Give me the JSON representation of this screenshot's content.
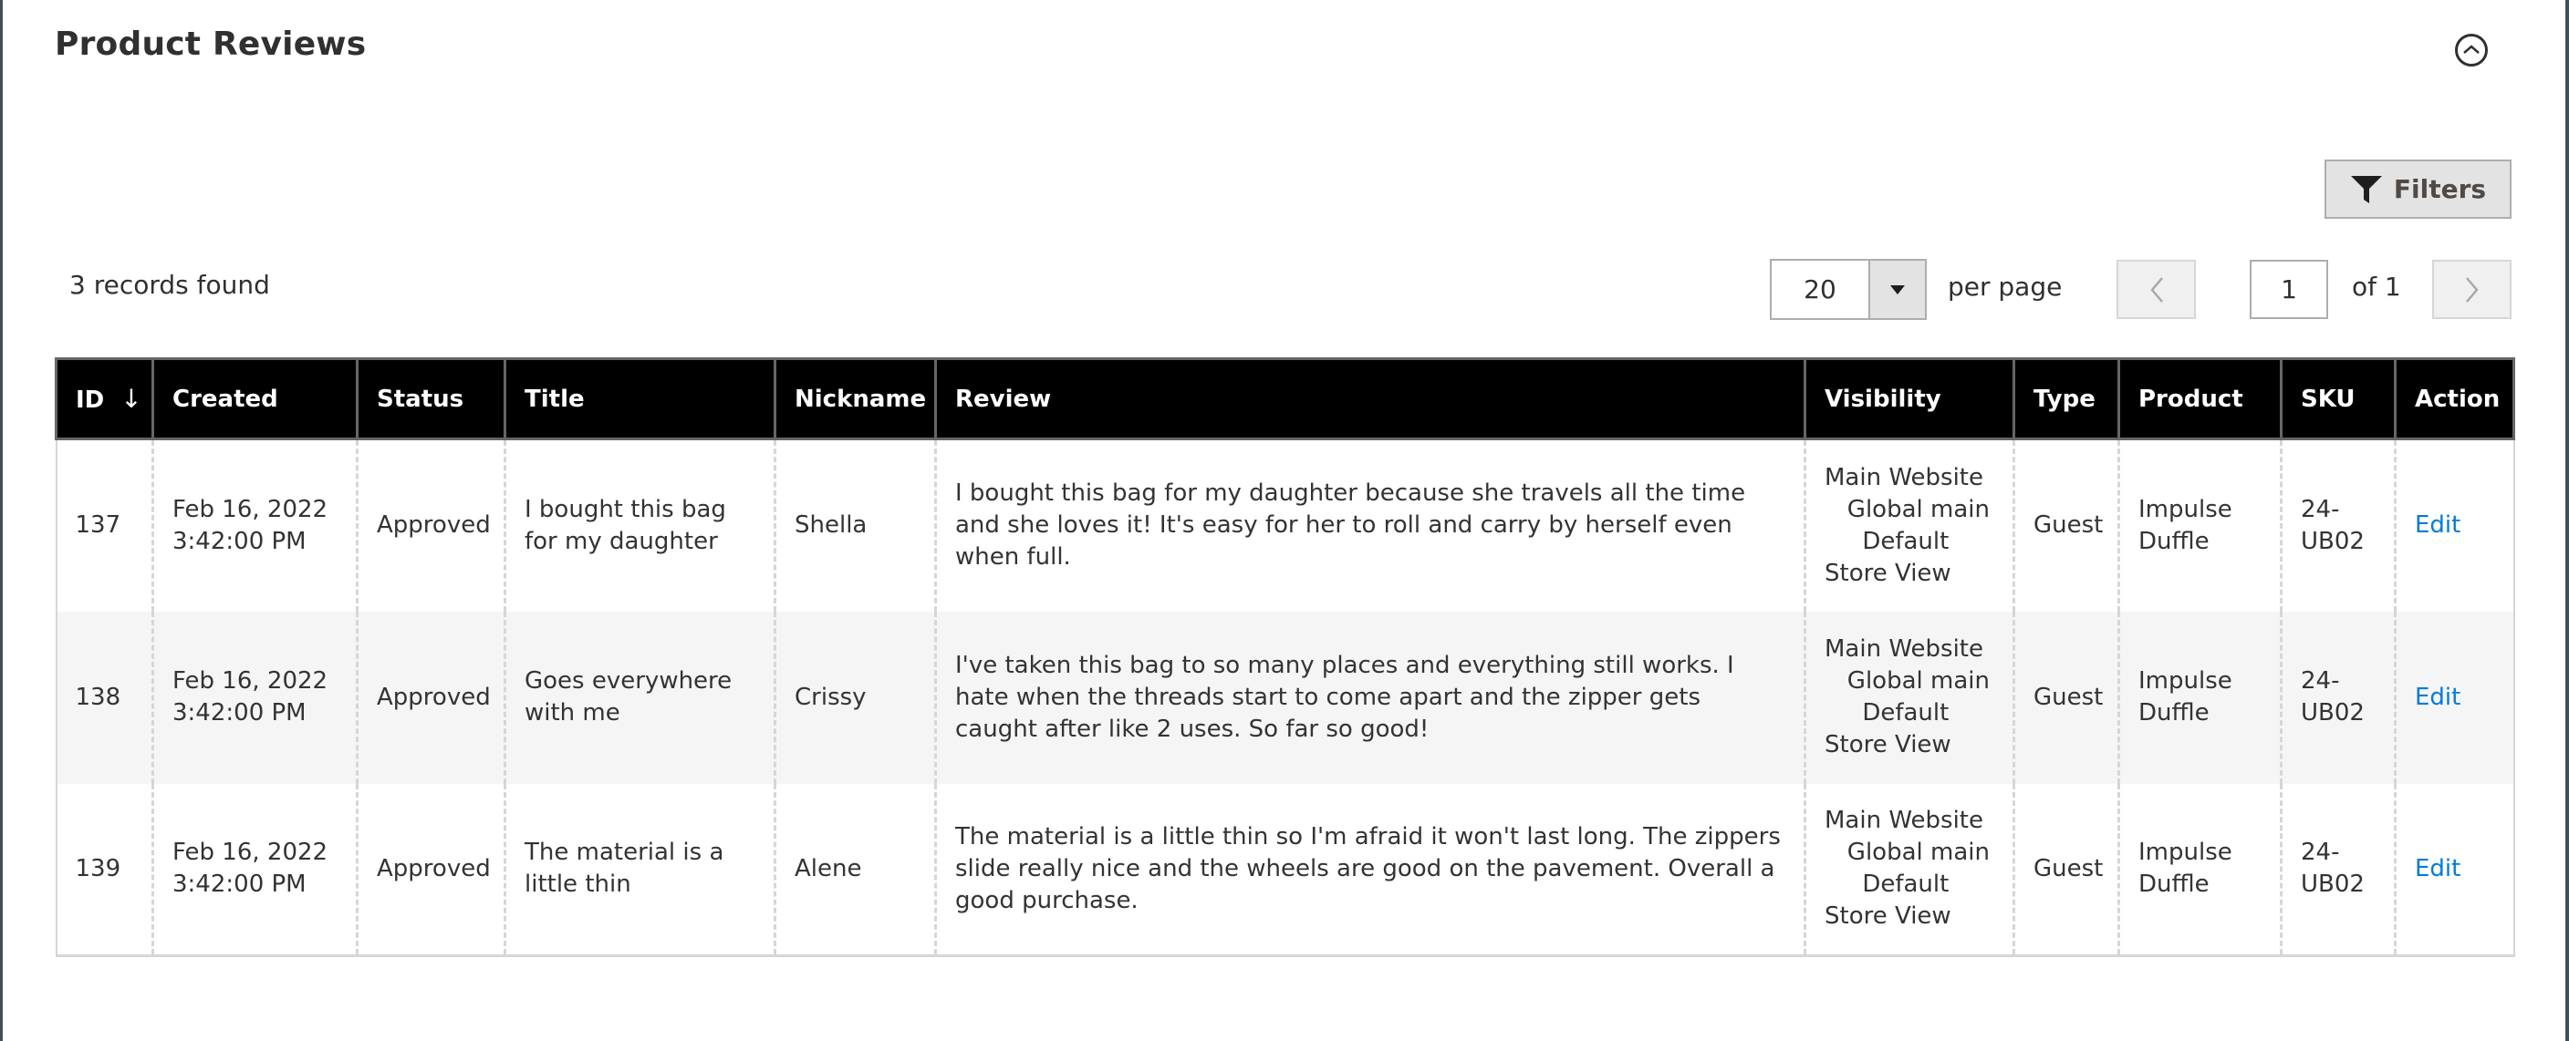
{
  "section": {
    "title": "Product Reviews",
    "collapse_icon": "chevron-up-circle-icon"
  },
  "toolbar": {
    "filters_label": "Filters",
    "filters_icon": "filter-funnel-icon",
    "records_found": "3 records found",
    "per_page_value": "20",
    "per_page_label": "per page",
    "current_page": "1",
    "page_of": "of 1",
    "prev_icon": "chevron-left-icon",
    "next_icon": "chevron-right-icon"
  },
  "grid": {
    "columns": [
      "ID",
      "Created",
      "Status",
      "Title",
      "Nickname",
      "Review",
      "Visibility",
      "Type",
      "Product",
      "SKU",
      "Action"
    ],
    "sort_indicator": "↓",
    "rows": [
      {
        "id": "137",
        "created": [
          "Feb 16, 2022",
          "3:42:00 PM"
        ],
        "status": "Approved",
        "title": "I bought this bag for my daughter",
        "nickname": "Shella",
        "review": "I bought this bag for my daughter because she travels all the time and she loves it! It's easy for her to roll and carry by herself even when full.",
        "visibility": [
          "Main Website",
          "   Global main",
          "     Default",
          "Store View"
        ],
        "type": "Guest",
        "product": "Impulse Duffle",
        "sku": "24-UB02",
        "action": "Edit"
      },
      {
        "id": "138",
        "created": [
          "Feb 16, 2022",
          "3:42:00 PM"
        ],
        "status": "Approved",
        "title": "Goes everywhere with me",
        "nickname": "Crissy",
        "review": "I've taken this bag to so many places and everything still works. I hate when the threads start to come apart and the zipper gets caught after like 2 uses. So far so good!",
        "visibility": [
          "Main Website",
          "   Global main",
          "     Default",
          "Store View"
        ],
        "type": "Guest",
        "product": "Impulse Duffle",
        "sku": "24-UB02",
        "action": "Edit"
      },
      {
        "id": "139",
        "created": [
          "Feb 16, 2022",
          "3:42:00 PM"
        ],
        "status": "Approved",
        "title": "The material is a little thin",
        "nickname": "Alene",
        "review": "The material is a little thin so I'm afraid it won't last long. The zippers slide really nice and the wheels are good on the pavement. Overall a good purchase.",
        "visibility": [
          "Main Website",
          "   Global main",
          "     Default",
          "Store View"
        ],
        "type": "Guest",
        "product": "Impulse Duffle",
        "sku": "24-UB02",
        "action": "Edit"
      }
    ]
  },
  "colors": {
    "header_bg": "#000000",
    "link": "#007bdb",
    "button_bg": "#e3e3e3",
    "page_border": "#3f4f5a"
  }
}
